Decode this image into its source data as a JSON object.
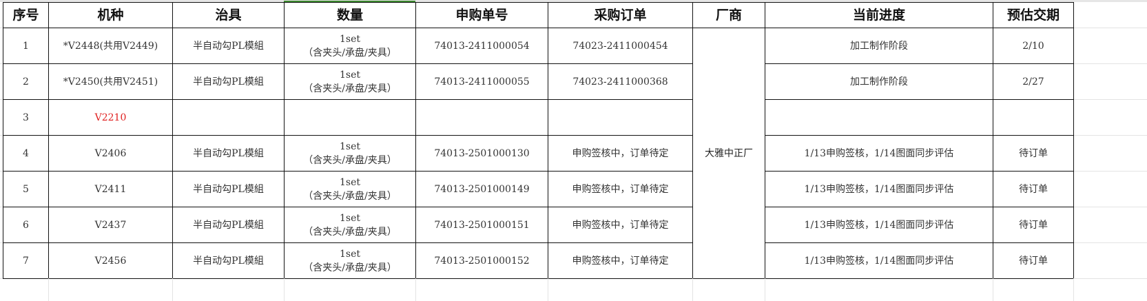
{
  "headers": [
    "序号",
    "机种",
    "治具",
    "数量",
    "申购单号",
    "采购订单",
    "厂商",
    "当前进度",
    "预估交期"
  ],
  "vendor": "大雅中正厂",
  "rows": [
    {
      "no": "1",
      "model": "*V2448(共用V2449)",
      "fixture": "半自动勾PL模組",
      "qty1": "1set",
      "qty2": "（含夹头/承盘/夹具）",
      "req": "74013-2411000054",
      "po": "74023-2411000454",
      "progress": "加工制作阶段",
      "eta": "2/10"
    },
    {
      "no": "2",
      "model": "*V2450(共用V2451)",
      "fixture": "半自动勾PL模組",
      "qty1": "1set",
      "qty2": "（含夹头/承盘/夹具）",
      "req": "74013-2411000055",
      "po": "74023-2411000368",
      "progress": "加工制作阶段",
      "eta": "2/27"
    },
    {
      "no": "3",
      "model": "V2210",
      "fixture": "",
      "qty1": "",
      "qty2": "",
      "req": "",
      "po": "",
      "progress": "",
      "eta": "",
      "model_color": "#e02020"
    },
    {
      "no": "4",
      "model": "V2406",
      "fixture": "半自动勾PL模組",
      "qty1": "1set",
      "qty2": "（含夹头/承盘/夹具）",
      "req": "74013-2501000130",
      "po": "申购签核中，订单待定",
      "progress": "1/13申购签核，1/14图面同步评估",
      "eta": "待订单"
    },
    {
      "no": "5",
      "model": "V2411",
      "fixture": "半自动勾PL模組",
      "qty1": "1set",
      "qty2": "（含夹头/承盘/夹具）",
      "req": "74013-2501000149",
      "po": "申购签核中，订单待定",
      "progress": "1/13申购签核，1/14图面同步评估",
      "eta": "待订单"
    },
    {
      "no": "6",
      "model": "V2437",
      "fixture": "半自动勾PL模組",
      "qty1": "1set",
      "qty2": "（含夹头/承盘/夹具）",
      "req": "74013-2501000151",
      "po": "申购签核中，订单待定",
      "progress": "1/13申购签核，1/14图面同步评估",
      "eta": "待订单"
    },
    {
      "no": "7",
      "model": "V2456",
      "fixture": "半自动勾PL模組",
      "qty1": "1set",
      "qty2": "（含夹头/承盘/夹具）",
      "req": "74013-2501000152",
      "po": "申购签核中，订单待定",
      "progress": "1/13申购签核，1/14图面同步评估",
      "eta": "待订单"
    }
  ]
}
